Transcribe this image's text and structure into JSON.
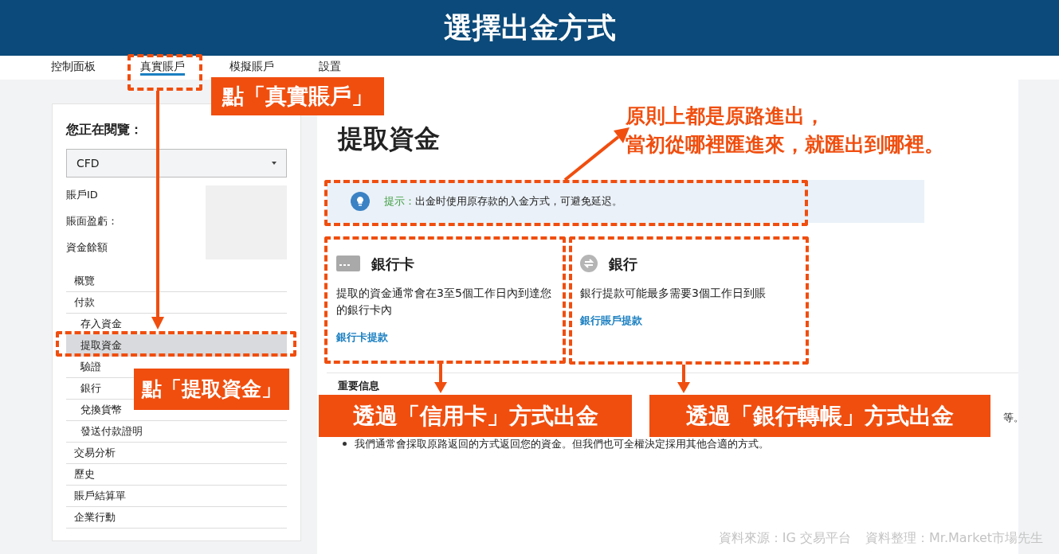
{
  "banner": {
    "title": "選擇出金方式"
  },
  "nav_tabs": [
    {
      "label": "控制面板",
      "selected": false
    },
    {
      "label": "真實賬戶",
      "selected": true
    },
    {
      "label": "模擬賬戶",
      "selected": false
    },
    {
      "label": "設置",
      "selected": false
    }
  ],
  "sidebar": {
    "heading": "您正在閱覽：",
    "account_select": {
      "value": "CFD"
    },
    "fields": [
      "賬戶ID",
      "賬面盈虧：",
      "資金餘額"
    ],
    "menu": [
      {
        "label": "概覽",
        "selected": false
      },
      {
        "label": "付款",
        "selected": false,
        "children": [
          {
            "label": "存入資金",
            "selected": false
          },
          {
            "label": "提取資金",
            "selected": true
          },
          {
            "label": "驗證",
            "selected": false
          },
          {
            "label": "銀行",
            "selected": false
          },
          {
            "label": "兌換貨幣",
            "selected": false
          },
          {
            "label": "發送付款證明",
            "selected": false
          }
        ]
      },
      {
        "label": "交易分析",
        "selected": false
      },
      {
        "label": "歷史",
        "selected": false
      },
      {
        "label": "賬戶結算單",
        "selected": false
      },
      {
        "label": "企業行動",
        "selected": false
      }
    ]
  },
  "main": {
    "title": "提取資金",
    "tip": {
      "label": "提示：",
      "text": "出金时使用原存款的入金方式，可避免延迟。"
    },
    "methods": [
      {
        "kind": "card",
        "title": "銀行卡",
        "description": "提取的資金通常會在3至5個工作日內到達您的銀行卡內",
        "link": "銀行卡提款"
      },
      {
        "kind": "bank",
        "title": "銀行",
        "description": "銀行提款可能最多需要3個工作日到賬",
        "link": "銀行賬戶提款"
      }
    ],
    "notice": {
      "heading": "重要信息",
      "fragment": "等。",
      "bullets": [
        "我們通常會採取原路返回的方式返回您的資金。但我們也可全權決定採用其他合適的方式。"
      ]
    }
  },
  "annotations": {
    "tab_label": "點「真實賬戶」",
    "menu_label": "點「提取資金」",
    "callout": [
      "原則上都是原路進出，",
      "當初從哪裡匯進來，就匯出到哪裡。"
    ],
    "card_label": "透過「信用卡」方式出金",
    "bank_label": "透過「銀行轉帳」方式出金"
  },
  "credits": [
    "資料來源：IG 交易平台",
    "資料整理：Mr.Market市場先生"
  ]
}
